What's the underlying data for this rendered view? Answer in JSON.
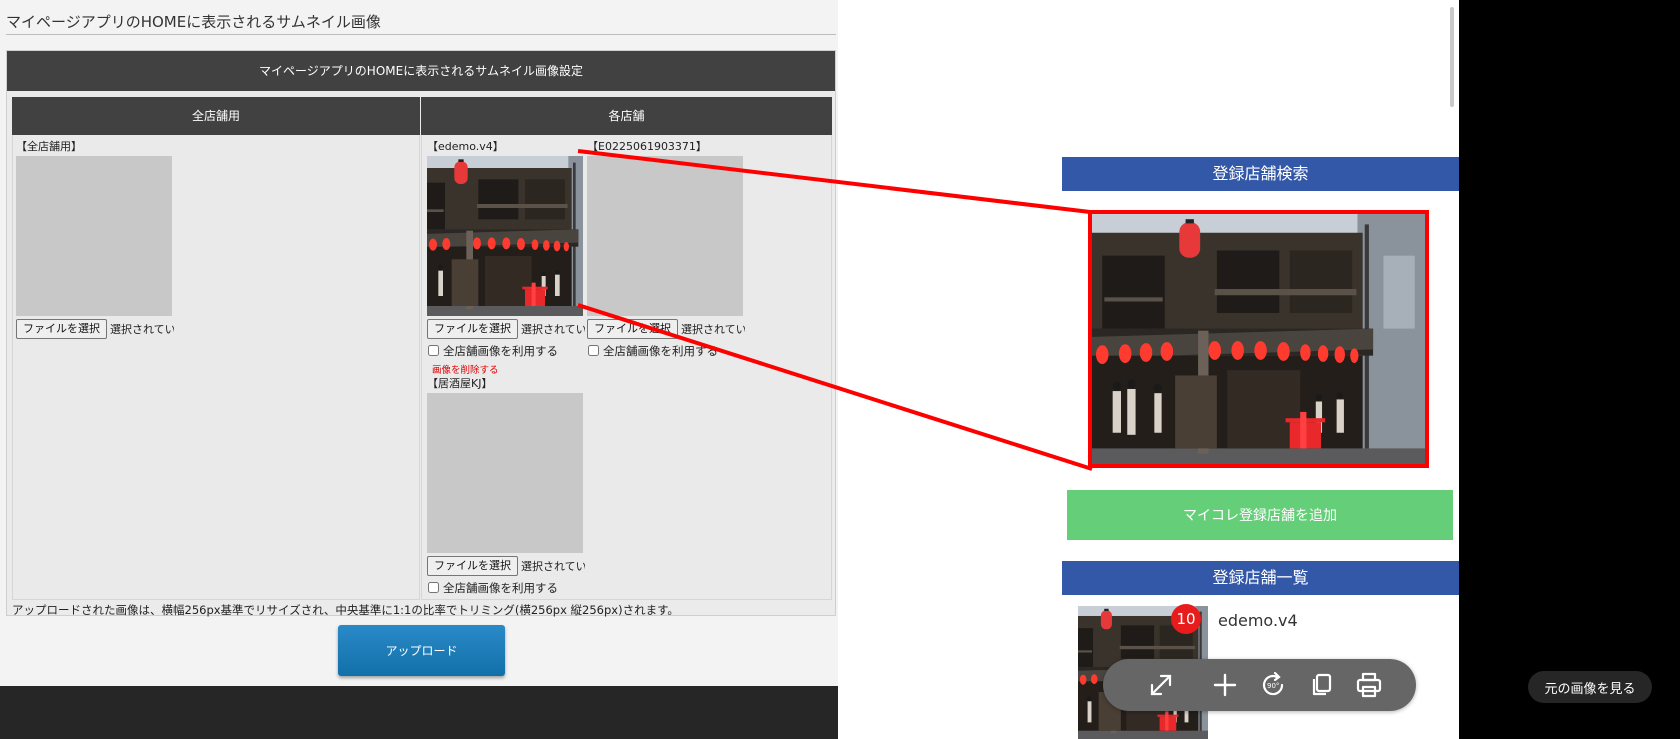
{
  "admin": {
    "title": "マイページアプリのHOMEに表示されるサムネイル画像",
    "settings_header": "マイページアプリのHOMEに表示されるサムネイル画像設定",
    "col_all_header": "全店舗用",
    "col_each_header": "各店舗",
    "all_store_slot": {
      "label": "【全店舗用】",
      "file_button": "ファイルを選択",
      "file_status": "選択されてい"
    },
    "store_slots": [
      {
        "label": "【edemo.v4】",
        "file_button": "ファイルを選択",
        "file_status": "選択されてい",
        "use_all_checkbox": "全店舗画像を利用する",
        "use_all_checked": false,
        "delete_link": "画像を削除する",
        "has_image": true
      },
      {
        "label": "【E0225061903371】",
        "file_button": "ファイルを選択",
        "file_status": "選択されてい",
        "use_all_checkbox": "全店舗画像を利用する",
        "use_all_checked": false,
        "has_image": false
      },
      {
        "label": "【居酒屋KJ】",
        "file_button": "ファイルを選択",
        "file_status": "選択されてい",
        "use_all_checkbox": "全店舗画像を利用する",
        "use_all_checked": false,
        "has_image": false
      }
    ],
    "note": "アップロードされた画像は、横幅256px基準でリサイズされ、中央基準に1:1の比率でトリミング(横256px 縦256px)されます。",
    "upload_button": "アップロード"
  },
  "phone": {
    "search_section_title": "登録店舗検索",
    "add_button": "マイコレ登録店舗を追加",
    "list_section_title": "登録店舗一覧",
    "list_item": {
      "name": "edemo.v4",
      "badge_count": "10"
    }
  },
  "viewer": {
    "tools": [
      "expand-icon",
      "zoom-in-icon",
      "rotate-90-icon",
      "copy-icon",
      "print-icon"
    ],
    "rotate_label": "90°",
    "view_original_button": "元の画像を見る"
  },
  "colors": {
    "header_dark": "#414141",
    "section_blue": "#3358a8",
    "add_green": "#64cf78",
    "highlight_red": "#ff0000",
    "badge_red": "#e81c1c",
    "upload_blue": "#1a7cb9"
  }
}
